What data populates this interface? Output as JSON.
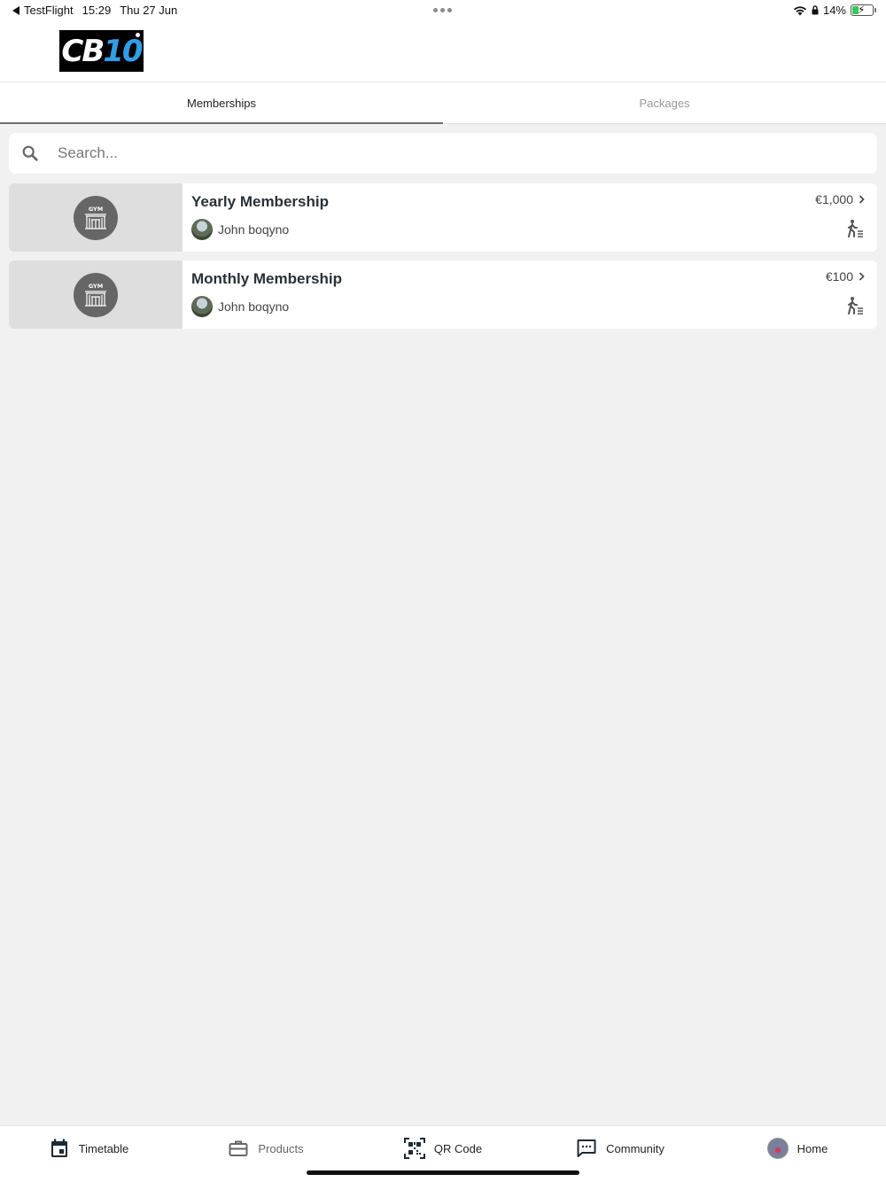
{
  "status_bar": {
    "back_app": "TestFlight",
    "time": "15:29",
    "date": "Thu 27 Jun",
    "battery": "14%"
  },
  "header": {
    "logo_text_a": "CB",
    "logo_text_b": "10"
  },
  "tabs": [
    {
      "label": "Memberships",
      "active": true
    },
    {
      "label": "Packages",
      "active": false
    }
  ],
  "search": {
    "placeholder": "Search..."
  },
  "memberships": [
    {
      "title": "Yearly Membership",
      "owner": "John boqyno",
      "price": "€1,000",
      "icon": "gym-icon"
    },
    {
      "title": "Monthly Membership",
      "owner": "John boqyno",
      "price": "€100",
      "icon": "gym-icon"
    }
  ],
  "bottom_nav": {
    "timetable": "Timetable",
    "products": "Products",
    "qr_code": "QR Code",
    "community": "Community",
    "home": "Home"
  },
  "colors": {
    "accent_blue": "#2f9fe6",
    "tab_indicator": "#707070",
    "background": "#f1f1f1"
  }
}
